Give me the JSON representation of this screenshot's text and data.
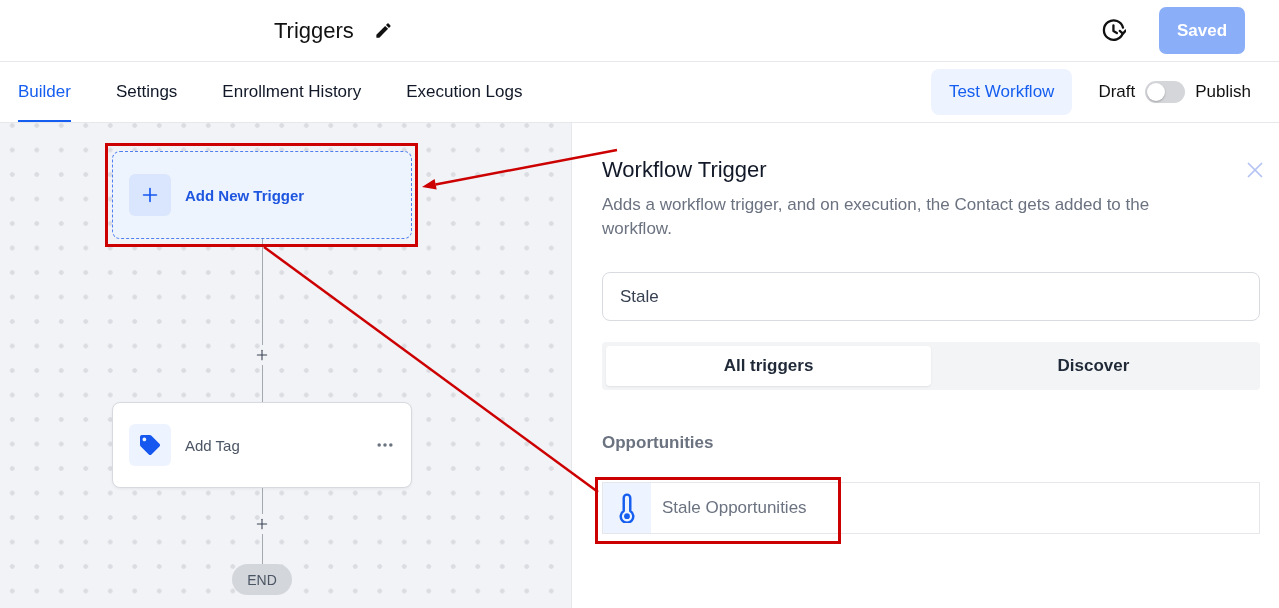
{
  "header": {
    "title": "Triggers",
    "save_button": {
      "label": "Saved",
      "disabled": true
    }
  },
  "tabs": [
    {
      "label": "Builder",
      "selected": true
    },
    {
      "label": "Settings",
      "selected": false
    },
    {
      "label": "Enrollment History",
      "selected": false
    },
    {
      "label": "Execution Logs",
      "selected": false
    }
  ],
  "test_button": "Test Workflow",
  "publish_toggle": {
    "off_label": "Draft",
    "on_label": "Publish",
    "on": false
  },
  "canvas": {
    "nodes": [
      {
        "kind": "trigger",
        "label": "Add New Trigger"
      },
      {
        "kind": "action",
        "label": "Add Tag"
      }
    ],
    "end_label": "END"
  },
  "panel": {
    "title": "Workflow Trigger",
    "description": "Adds a workflow trigger, and on execution, the Contact gets added to the workflow.",
    "search": {
      "value": "Stale"
    },
    "segments": [
      {
        "label": "All triggers",
        "selected": true
      },
      {
        "label": "Discover",
        "selected": false
      }
    ],
    "sections": [
      {
        "title": "Opportunities",
        "items": [
          {
            "label": "Stale Opportunities"
          }
        ]
      }
    ]
  }
}
